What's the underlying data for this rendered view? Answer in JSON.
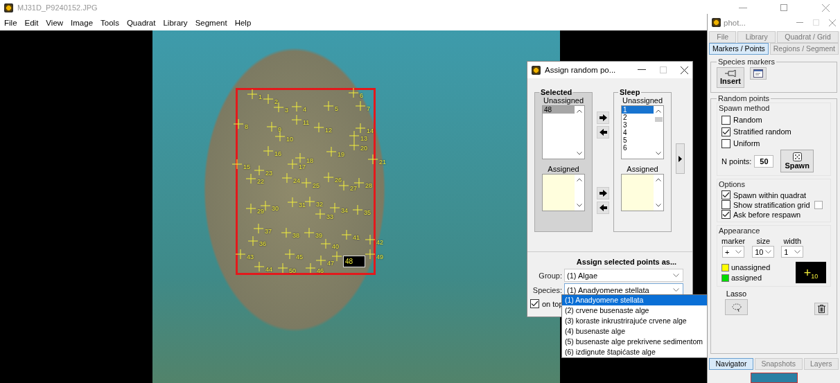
{
  "main_window": {
    "title": "MJ31D_P9240152.JPG",
    "menu": [
      "File",
      "Edit",
      "View",
      "Image",
      "Tools",
      "Quadrat",
      "Library",
      "Segment",
      "Help"
    ]
  },
  "image_view": {
    "markers": [
      {
        "label": "1",
        "selected": false
      },
      {
        "label": "2",
        "selected": false
      },
      {
        "label": "3",
        "selected": false
      },
      {
        "label": "4",
        "selected": false
      },
      {
        "label": "5",
        "selected": false
      },
      {
        "label": "6",
        "selected": false
      },
      {
        "label": "7",
        "selected": false
      },
      {
        "label": "8",
        "selected": false
      },
      {
        "label": "9",
        "selected": false
      },
      {
        "label": "10",
        "selected": false
      },
      {
        "label": "11",
        "selected": false
      },
      {
        "label": "12",
        "selected": false
      },
      {
        "label": "13",
        "selected": false
      },
      {
        "label": "14",
        "selected": false
      },
      {
        "label": "15",
        "selected": false
      },
      {
        "label": "16",
        "selected": false
      },
      {
        "label": "17",
        "selected": false
      },
      {
        "label": "18",
        "selected": false
      },
      {
        "label": "19",
        "selected": false
      },
      {
        "label": "20",
        "selected": false
      },
      {
        "label": "21",
        "selected": false
      },
      {
        "label": "22",
        "selected": false
      },
      {
        "label": "23",
        "selected": false
      },
      {
        "label": "24",
        "selected": false
      },
      {
        "label": "25",
        "selected": false
      },
      {
        "label": "26",
        "selected": false
      },
      {
        "label": "27",
        "selected": false
      },
      {
        "label": "28",
        "selected": false
      },
      {
        "label": "29",
        "selected": false
      },
      {
        "label": "30",
        "selected": false
      },
      {
        "label": "31",
        "selected": false
      },
      {
        "label": "32",
        "selected": false
      },
      {
        "label": "33",
        "selected": false
      },
      {
        "label": "34",
        "selected": false
      },
      {
        "label": "35",
        "selected": false
      },
      {
        "label": "36",
        "selected": false
      },
      {
        "label": "37",
        "selected": false
      },
      {
        "label": "38",
        "selected": false
      },
      {
        "label": "39",
        "selected": false
      },
      {
        "label": "40",
        "selected": false
      },
      {
        "label": "41",
        "selected": false
      },
      {
        "label": "42",
        "selected": false
      },
      {
        "label": "43",
        "selected": false
      },
      {
        "label": "44",
        "selected": false
      },
      {
        "label": "45",
        "selected": false
      },
      {
        "label": "46",
        "selected": false
      },
      {
        "label": "47",
        "selected": false
      },
      {
        "label": "48",
        "selected": true
      },
      {
        "label": "49",
        "selected": false
      },
      {
        "label": "50",
        "selected": false
      }
    ]
  },
  "assign_dialog": {
    "title": "Assign random po...",
    "panels": [
      {
        "title": "Selected",
        "unassigned_label": "Unassigned",
        "unassigned_items": [
          {
            "label": "48",
            "selected": true
          }
        ],
        "assigned_label": "Assigned"
      },
      {
        "title": "Sleep",
        "unassigned_label": "Unassigned",
        "unassigned_items": [
          {
            "label": "1",
            "selected": true
          },
          {
            "label": "2",
            "selected": false
          },
          {
            "label": "3",
            "selected": false
          },
          {
            "label": "4",
            "selected": false
          },
          {
            "label": "5",
            "selected": false
          },
          {
            "label": "6",
            "selected": false
          }
        ],
        "assigned_label": "Assigned"
      }
    ],
    "heading": "Assign selected points as...",
    "group": {
      "label": "Group:",
      "value": "(1) Algae"
    },
    "species": {
      "label": "Species:",
      "value": "(1) Anadyomene stellata",
      "expanded": true,
      "options": [
        {
          "label": "(1) Anadyomene stellata",
          "selected": true
        },
        {
          "label": "(2) crvene busenaste alge",
          "selected": false
        },
        {
          "label": "(3) koraste inkrustrirajuće crvene alge",
          "selected": false
        },
        {
          "label": "(4) busenaste alge",
          "selected": false
        },
        {
          "label": "(5) busenaste alge prekrivene sedimentom",
          "selected": false
        },
        {
          "label": "(6) izdignute štapićaste alge",
          "selected": false
        }
      ]
    },
    "on_top": {
      "label": "on top",
      "checked": true
    }
  },
  "tool_panel": {
    "title": "phot...",
    "tab_rows": [
      [
        {
          "label": "File",
          "selected": false
        },
        {
          "label": "Library",
          "selected": false
        },
        {
          "label": "Quadrat / Grid",
          "selected": false
        }
      ],
      [
        {
          "label": "Markers / Points",
          "selected": true
        },
        {
          "label": "Regions / Segment",
          "selected": false
        }
      ]
    ],
    "species_markers": {
      "title": "Species markers",
      "insert_button": "Insert"
    },
    "random_points": {
      "title": "Random points",
      "spawn_method": {
        "title": "Spawn method",
        "options": [
          {
            "label": "Random",
            "checked": false
          },
          {
            "label": "Stratified random",
            "checked": true
          },
          {
            "label": "Uniform",
            "checked": false
          }
        ]
      },
      "n_points": {
        "label": "N points:",
        "value": "50"
      },
      "spawn_button": "Spawn",
      "options": {
        "title": "Options",
        "items": [
          {
            "label": "Spawn within quadrat",
            "checked": true,
            "swatch": false
          },
          {
            "label": "Show stratification grid",
            "checked": false,
            "swatch": true
          },
          {
            "label": "Ask before respawn",
            "checked": true,
            "swatch": false
          }
        ]
      },
      "appearance": {
        "title": "Appearance",
        "selects": [
          {
            "label": "marker",
            "value": "+"
          },
          {
            "label": "size",
            "value": "10"
          },
          {
            "label": "width",
            "value": "1"
          }
        ],
        "legend": [
          {
            "label": "unassigned",
            "color": "#ffff00"
          },
          {
            "label": "assigned",
            "color": "#00dd00"
          }
        ],
        "preview": {
          "symbol": "+",
          "size": "10"
        }
      },
      "lasso": {
        "label": "Lasso"
      }
    },
    "bottom_tabs": [
      {
        "label": "Navigator",
        "selected": true
      },
      {
        "label": "Snapshots",
        "selected": false
      },
      {
        "label": "Layers",
        "selected": false
      }
    ]
  }
}
